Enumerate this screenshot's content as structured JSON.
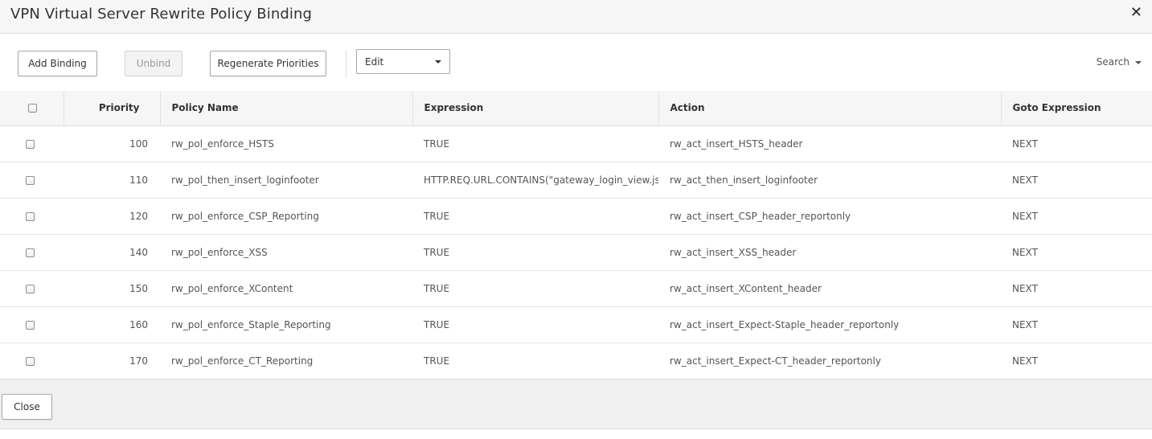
{
  "dialog": {
    "title": "VPN Virtual Server Rewrite Policy Binding",
    "close_glyph": "✕"
  },
  "toolbar": {
    "add_binding_label": "Add Binding",
    "unbind_label": "Unbind",
    "unbind_disabled": true,
    "regenerate_label": "Regenerate Priorities",
    "edit_select": {
      "selected": "Edit"
    },
    "search_label": "Search"
  },
  "table": {
    "columns": [
      "Priority",
      "Policy Name",
      "Expression",
      "Action",
      "Goto Expression"
    ],
    "rows": [
      {
        "priority": "100",
        "policy_name": "rw_pol_enforce_HSTS",
        "expression": "TRUE",
        "action": "rw_act_insert_HSTS_header",
        "goto": "NEXT"
      },
      {
        "priority": "110",
        "policy_name": "rw_pol_then_insert_loginfooter",
        "expression": "HTTP.REQ.URL.CONTAINS(\"gateway_login_view.js\")",
        "action": "rw_act_then_insert_loginfooter",
        "goto": "NEXT"
      },
      {
        "priority": "120",
        "policy_name": "rw_pol_enforce_CSP_Reporting",
        "expression": "TRUE",
        "action": "rw_act_insert_CSP_header_reportonly",
        "goto": "NEXT"
      },
      {
        "priority": "140",
        "policy_name": "rw_pol_enforce_XSS",
        "expression": "TRUE",
        "action": "rw_act_insert_XSS_header",
        "goto": "NEXT"
      },
      {
        "priority": "150",
        "policy_name": "rw_pol_enforce_XContent",
        "expression": "TRUE",
        "action": "rw_act_insert_XContent_header",
        "goto": "NEXT"
      },
      {
        "priority": "160",
        "policy_name": "rw_pol_enforce_Staple_Reporting",
        "expression": "TRUE",
        "action": "rw_act_insert_Expect-Staple_header_reportonly",
        "goto": "NEXT"
      },
      {
        "priority": "170",
        "policy_name": "rw_pol_enforce_CT_Reporting",
        "expression": "TRUE",
        "action": "rw_act_insert_Expect-CT_header_reportonly",
        "goto": "NEXT"
      }
    ]
  },
  "footer": {
    "close_label": "Close"
  }
}
